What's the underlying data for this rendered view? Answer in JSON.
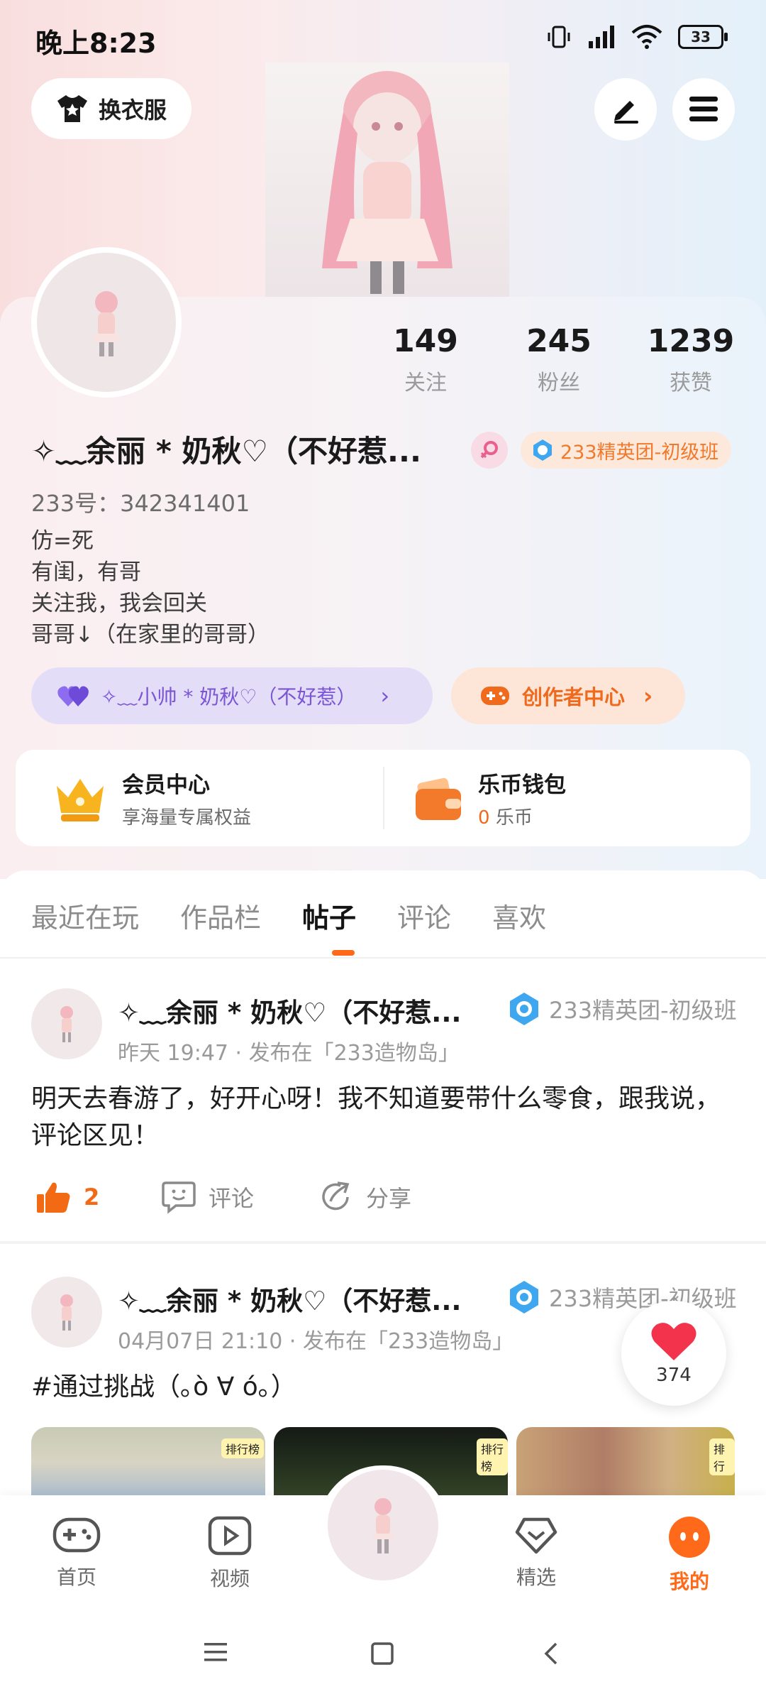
{
  "status_bar": {
    "time": "晚上8:23",
    "battery": "33"
  },
  "header": {
    "dress_button_label": "换衣服"
  },
  "profile": {
    "stats": [
      {
        "value": "149",
        "label": "关注"
      },
      {
        "value": "245",
        "label": "粉丝"
      },
      {
        "value": "1239",
        "label": "获赞"
      }
    ],
    "nickname": "✧﹏余丽 * 奶秋♡（不好惹...",
    "badge": "233精英团-初级班",
    "uid": "233号：342341401",
    "bio": [
      "仿=死",
      "有闺，有哥",
      "关注我，我会回关",
      "哥哥↓（在家里的哥哥）"
    ],
    "relation_pill": "✧﹏小帅 * 奶秋♡（不好惹）",
    "creator_center": "创作者中心"
  },
  "member": {
    "vip_title": "会员中心",
    "vip_sub": "享海量专属权益",
    "wallet_title": "乐币钱包",
    "wallet_amount": "0",
    "wallet_unit": "乐币"
  },
  "tabs": [
    "最近在玩",
    "作品栏",
    "帖子",
    "评论",
    "喜欢"
  ],
  "active_tab": "帖子",
  "posts": [
    {
      "author": "✧﹏余丽 * 奶秋♡（不好惹...",
      "badge": "233精英团-初级班",
      "meta": "昨天 19:47 · 发布在「233造物岛」",
      "text": "明天去春游了，好开心呀！我不知道要带什么零食，跟我说，评论区见！",
      "likes": "2",
      "comment_label": "评论",
      "share_label": "分享"
    },
    {
      "author": "✧﹏余丽 * 奶秋♡（不好惹...",
      "badge": "233精英团-初级班",
      "meta": "04月07日 21:10 · 发布在「233造物岛」",
      "text": "#通过挑战（｡ò ∀ ó｡）",
      "thumb_tags": [
        "排行榜",
        "排行榜",
        "排行"
      ]
    }
  ],
  "float_like_count": "374",
  "bottom_nav": [
    {
      "label": "首页"
    },
    {
      "label": "视频"
    },
    {
      "label": "精选"
    },
    {
      "label": "我的"
    }
  ],
  "colors": {
    "accent": "#ff6a1a",
    "purple": "#7a55d6",
    "badge_orange": "#ef7a2b"
  }
}
